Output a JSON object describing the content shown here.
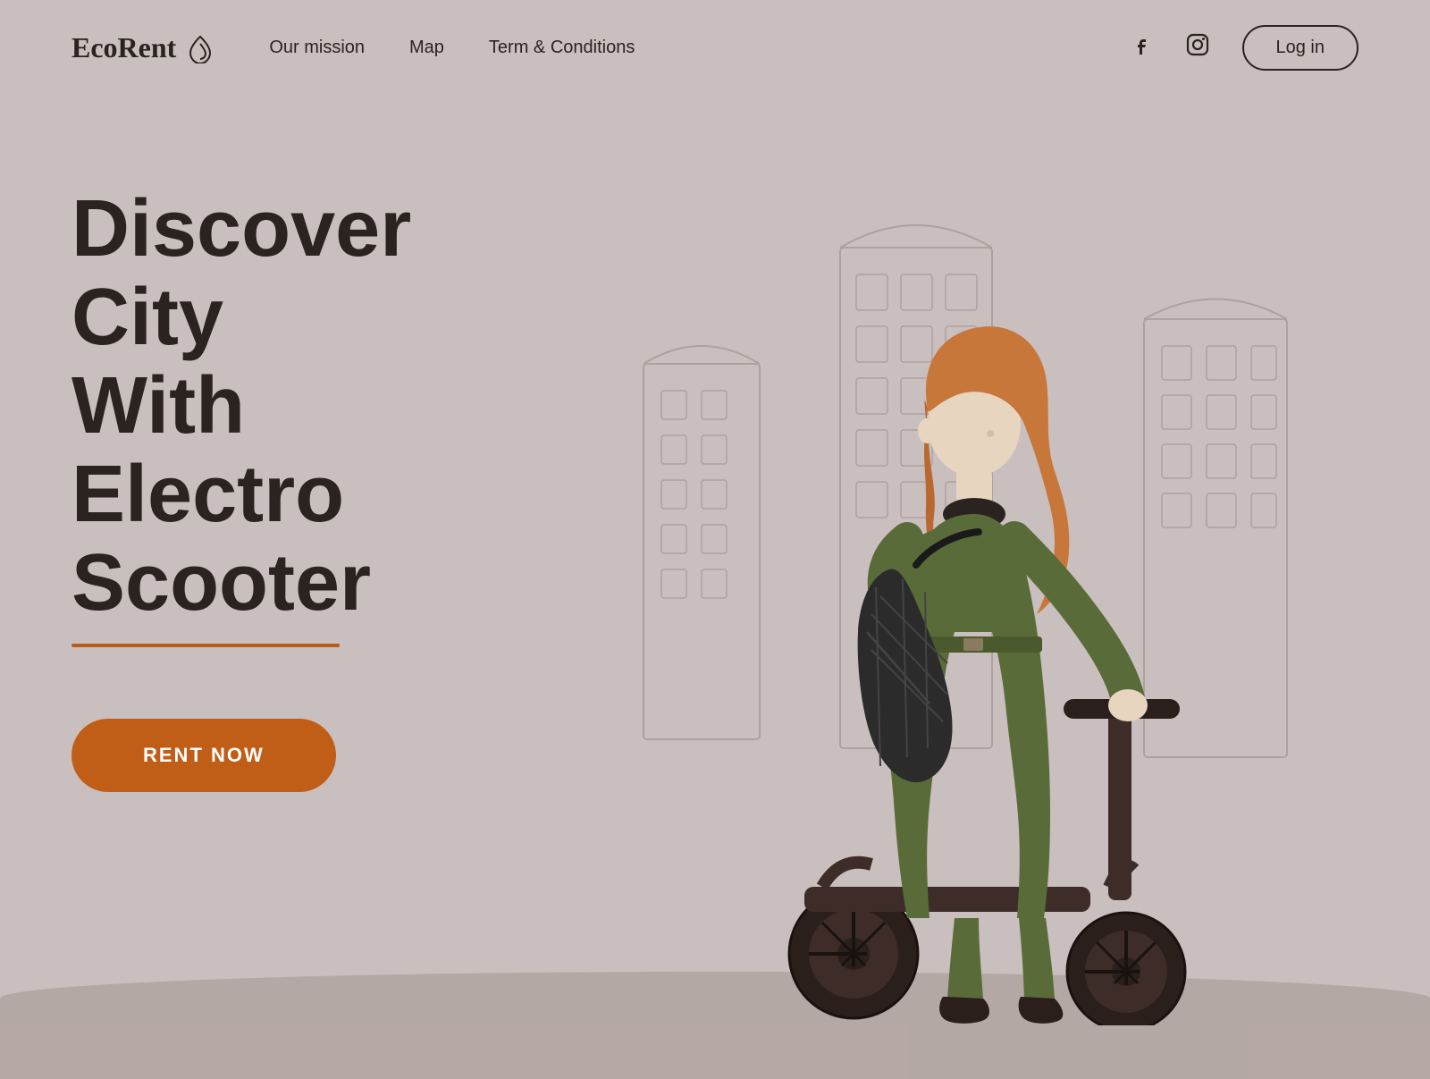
{
  "nav": {
    "logo_text": "EcoRent",
    "links": [
      {
        "label": "Our mission",
        "name": "nav-our-mission"
      },
      {
        "label": "Map",
        "name": "nav-map"
      },
      {
        "label": "Term & Conditions",
        "name": "nav-terms"
      }
    ],
    "social": [
      {
        "name": "facebook-icon",
        "symbol": "f"
      },
      {
        "name": "instagram-icon",
        "symbol": "○"
      }
    ],
    "login_label": "Log in"
  },
  "hero": {
    "headline_line1": "Discover City",
    "headline_line2": "With Electro",
    "headline_line3": "Scooter",
    "rent_button_label": "RENT NOW"
  },
  "colors": {
    "background": "#c9bfbe",
    "text_dark": "#2b2320",
    "accent_orange": "#c05e18",
    "building_stroke": "#a09090"
  }
}
